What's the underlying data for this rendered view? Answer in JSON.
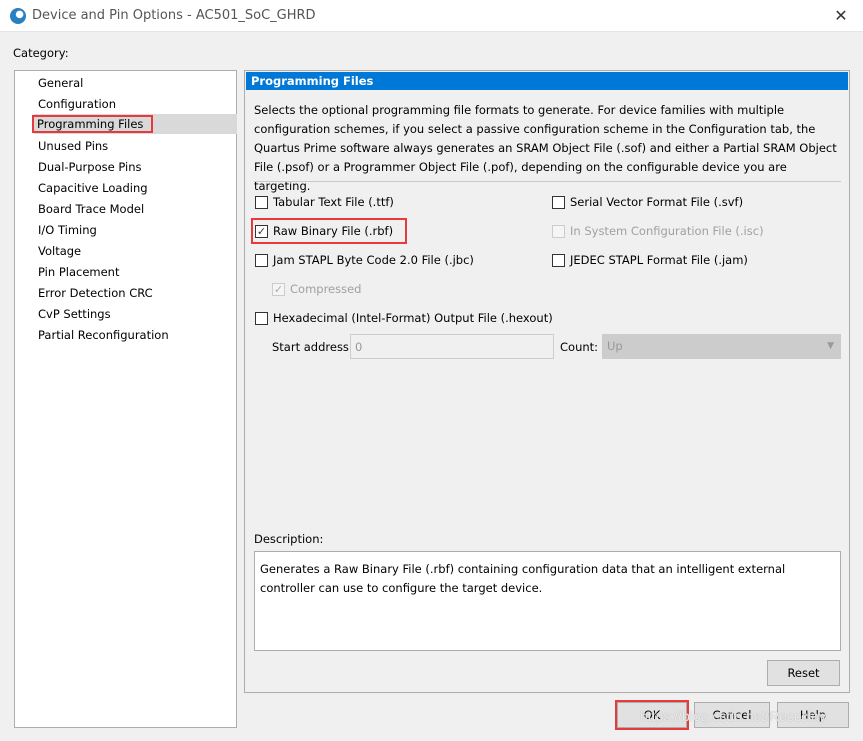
{
  "window": {
    "title": "Device and Pin Options - AC501_SoC_GHRD",
    "close": "✕"
  },
  "category": {
    "label": "Category:",
    "items": [
      "General",
      "Configuration",
      "Programming Files",
      "Unused Pins",
      "Dual-Purpose Pins",
      "Capacitive Loading",
      "Board Trace Model",
      "I/O Timing",
      "Voltage",
      "Pin Placement",
      "Error Detection CRC",
      "CvP Settings",
      "Partial Reconfiguration"
    ],
    "selected": "Programming Files"
  },
  "panel": {
    "title": "Programming Files",
    "intro": "Selects the optional programming file formats to generate. For device families with multiple configuration schemes, if you select a passive configuration scheme in the Configuration tab, the Quartus Prime software always generates an SRAM Object File (.sof) and either a Partial SRAM Object File (.psof) or a Programmer Object File (.pof), depending on the configurable device you are targeting.",
    "options": {
      "ttf": {
        "label": "Tabular Text File (.ttf)",
        "checked": false
      },
      "svf": {
        "label": "Serial Vector Format File (.svf)",
        "checked": false
      },
      "rbf": {
        "label": "Raw Binary File (.rbf)",
        "checked": true
      },
      "isc": {
        "label": "In System Configuration File (.isc)",
        "checked": false,
        "disabled": true
      },
      "jbc": {
        "label": "Jam STAPL Byte Code 2.0 File (.jbc)",
        "checked": false
      },
      "jam": {
        "label": "JEDEC STAPL Format File (.jam)",
        "checked": false
      },
      "compressed": {
        "label": "Compressed",
        "checked": true,
        "disabled": true
      },
      "hexout": {
        "label": "Hexadecimal (Intel-Format) Output File (.hexout)",
        "checked": false
      }
    },
    "start_address": {
      "label": "Start address:",
      "value": "0"
    },
    "count": {
      "label": "Count:",
      "value": "Up"
    },
    "description": {
      "label": "Description:",
      "text": "Generates a Raw Binary File (.rbf) containing configuration data that an intelligent external controller can use to configure the target device."
    },
    "reset": "Reset"
  },
  "buttons": {
    "ok": "OK",
    "cancel": "Cancel",
    "help": "Help"
  },
  "watermark": "https://blog.csdn.net/Reccclay"
}
